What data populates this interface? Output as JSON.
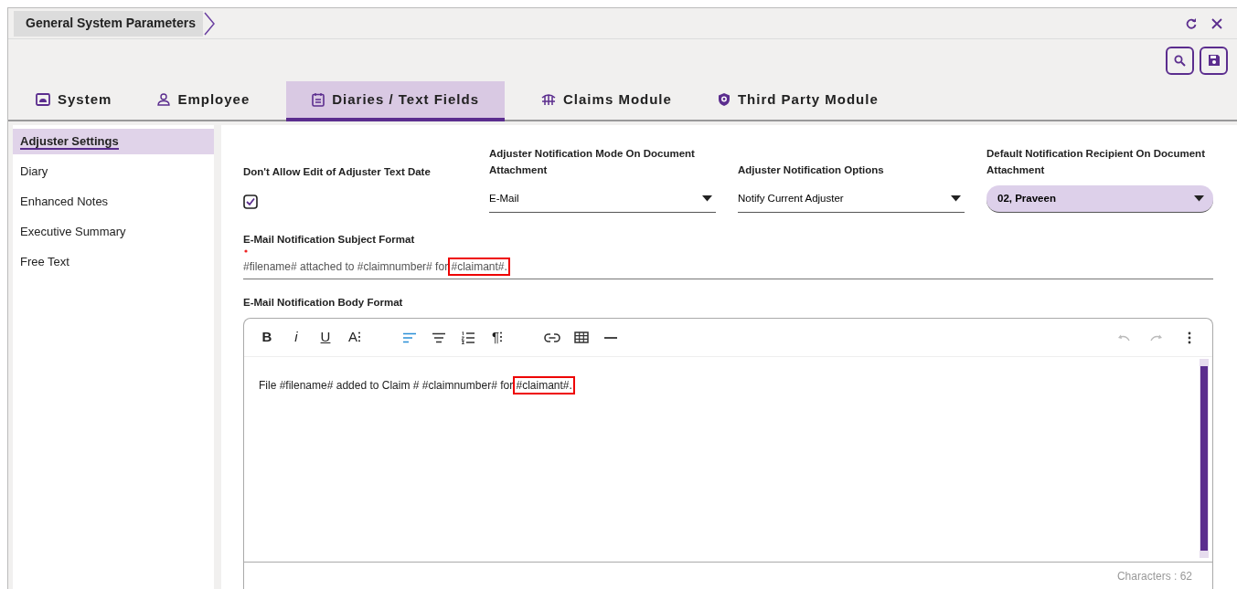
{
  "window": {
    "title": "General System Parameters"
  },
  "tabs": [
    {
      "label": "System",
      "selected": false
    },
    {
      "label": "Employee",
      "selected": false
    },
    {
      "label": "Diaries / Text Fields",
      "selected": true
    },
    {
      "label": "Claims Module",
      "selected": false
    },
    {
      "label": "Third Party Module",
      "selected": false
    }
  ],
  "sidebar": {
    "items": [
      {
        "label": "Adjuster Settings",
        "selected": true
      },
      {
        "label": "Diary",
        "selected": false
      },
      {
        "label": "Enhanced Notes",
        "selected": false
      },
      {
        "label": "Executive Summary",
        "selected": false
      },
      {
        "label": "Free Text",
        "selected": false
      }
    ]
  },
  "settings": {
    "checkbox": {
      "label": "Don't Allow Edit of Adjuster Text Date",
      "checked": true
    },
    "dropdowns": [
      {
        "label": "Adjuster Notification Mode On Document Attachment",
        "value": "E-Mail",
        "focused": false
      },
      {
        "label": "Adjuster Notification Options",
        "value": "Notify Current Adjuster",
        "focused": false
      },
      {
        "label": "Default Notification Recipient On Document Attachment",
        "value": "02, Praveen",
        "focused": true
      }
    ]
  },
  "subject": {
    "label": "E-Mail Notification Subject Format",
    "required": true,
    "parts": [
      {
        "text": "#filename# attached to #claimnumber# for ",
        "highlighted": false
      },
      {
        "text": "#claimant#.",
        "highlighted": true
      }
    ]
  },
  "body": {
    "label": "E-Mail Notification Body Format",
    "toolbar_groups": [
      [
        {
          "kind": "text",
          "label": "B"
        },
        {
          "kind": "text",
          "label": "i"
        },
        {
          "kind": "text",
          "label": "U"
        },
        {
          "kind": "text",
          "label": "A⁝"
        }
      ],
      [
        {
          "kind": "icon",
          "active": true
        },
        {
          "kind": "icon",
          "active": false
        },
        {
          "kind": "icon",
          "active": false
        },
        {
          "kind": "text",
          "label": "¶⁝"
        }
      ],
      [
        {
          "kind": "icon",
          "active": false
        },
        {
          "kind": "icon",
          "active": false
        },
        {
          "kind": "icon",
          "active": false
        }
      ]
    ],
    "parts": [
      {
        "text": "File #filename# added to Claim # #claimnumber# for ",
        "highlighted": false
      },
      {
        "text": "#claimant#.",
        "highlighted": true
      }
    ],
    "char_count": "Characters : 62"
  }
}
